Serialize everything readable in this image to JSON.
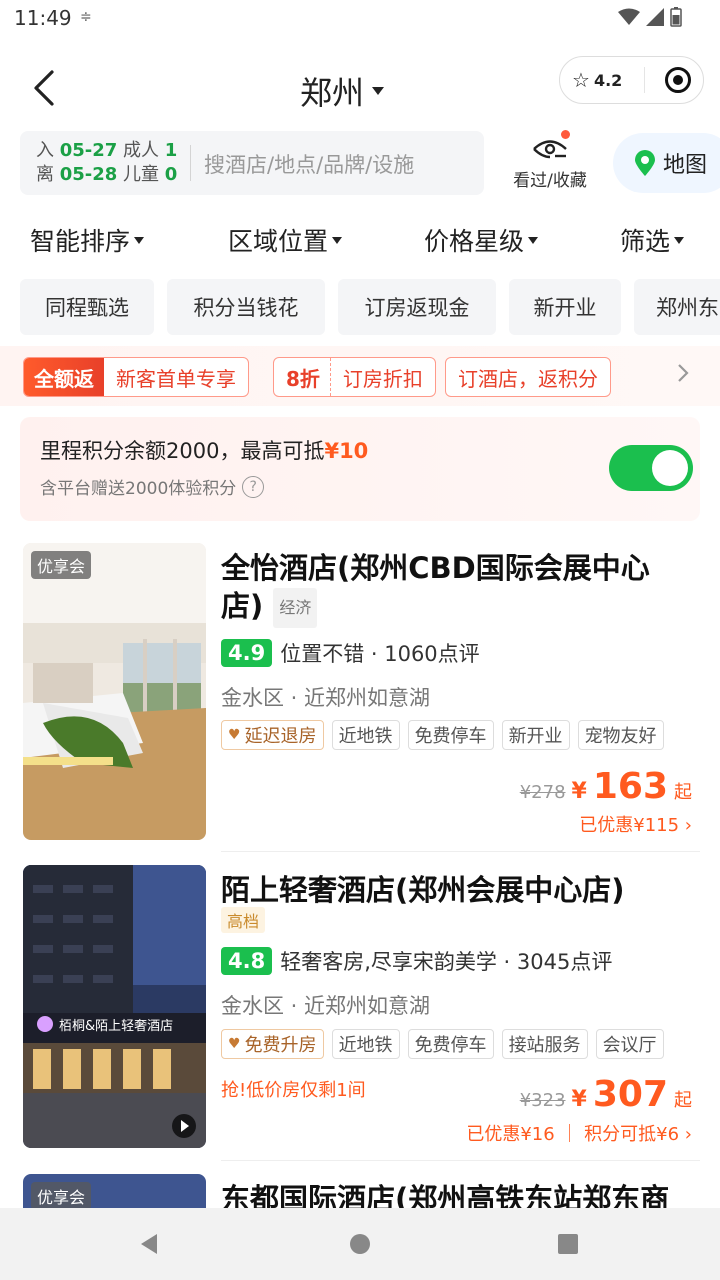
{
  "status_bar": {
    "time": "11:49"
  },
  "header": {
    "city": "郑州",
    "rating": "4.2"
  },
  "search": {
    "checkin_label": "入",
    "checkin_date": "05-27",
    "adults_label": "成人",
    "adults": "1",
    "checkout_label": "离",
    "checkout_date": "05-28",
    "children_label": "儿童",
    "children": "0",
    "placeholder": "搜酒店/地点/品牌/设施",
    "history_label": "看过/收藏",
    "map_label": "地图"
  },
  "sort_tabs": [
    "智能排序",
    "区域位置",
    "价格星级",
    "筛选"
  ],
  "quick_chips": [
    "同程甄选",
    "积分当钱花",
    "订房返现金",
    "新开业",
    "郑州东"
  ],
  "promo": {
    "tag1_highlight": "全额返",
    "tag1_text": "新客首单专享",
    "tag2_highlight": "8折",
    "tag2_text": "订房折扣",
    "tag3_text": "订酒店，返积分"
  },
  "points": {
    "line1_prefix": "里程积分余额2000，最高可抵",
    "line1_amount": "¥10",
    "line2": "含平台赠送2000体验积分",
    "toggle_on": true
  },
  "hotels": [
    {
      "badge": "优享会",
      "name": "全怡酒店(郑州CBD国际会展中心店)",
      "grade": "经济",
      "score": "4.9",
      "comment": "位置不错 · 1060点评",
      "location": "金水区 · 近郑州如意湖",
      "highlight_tag": "延迟退房",
      "tags": [
        "近地铁",
        "免费停车",
        "新开业",
        "宠物友好"
      ],
      "original_price": "¥278",
      "yen": "¥",
      "price": "163",
      "qi": "起",
      "discount": "已优惠¥115"
    },
    {
      "name": "陌上轻奢酒店(郑州会展中心店)",
      "grade": "高档",
      "score": "4.8",
      "comment": "轻奢客房,尽享宋韵美学 · 3045点评",
      "location": "金水区 · 近郑州如意湖",
      "highlight_tag": "免费升房",
      "tags": [
        "近地铁",
        "免费停车",
        "接站服务",
        "会议厅"
      ],
      "urgent": "抢!低价房仅剩1间",
      "original_price": "¥323",
      "yen": "¥",
      "price": "307",
      "qi": "起",
      "discount": "已优惠¥16 ｜ 积分可抵¥6",
      "image_sign": "栢桐&陌上轻奢酒店"
    },
    {
      "badge": "优享会",
      "name": "东都国际酒店(郑州高铁东站郑东商"
    }
  ],
  "colors": {
    "accent": "#ff5a1f",
    "green": "#1bbf4e",
    "date_green": "#1ba046"
  }
}
